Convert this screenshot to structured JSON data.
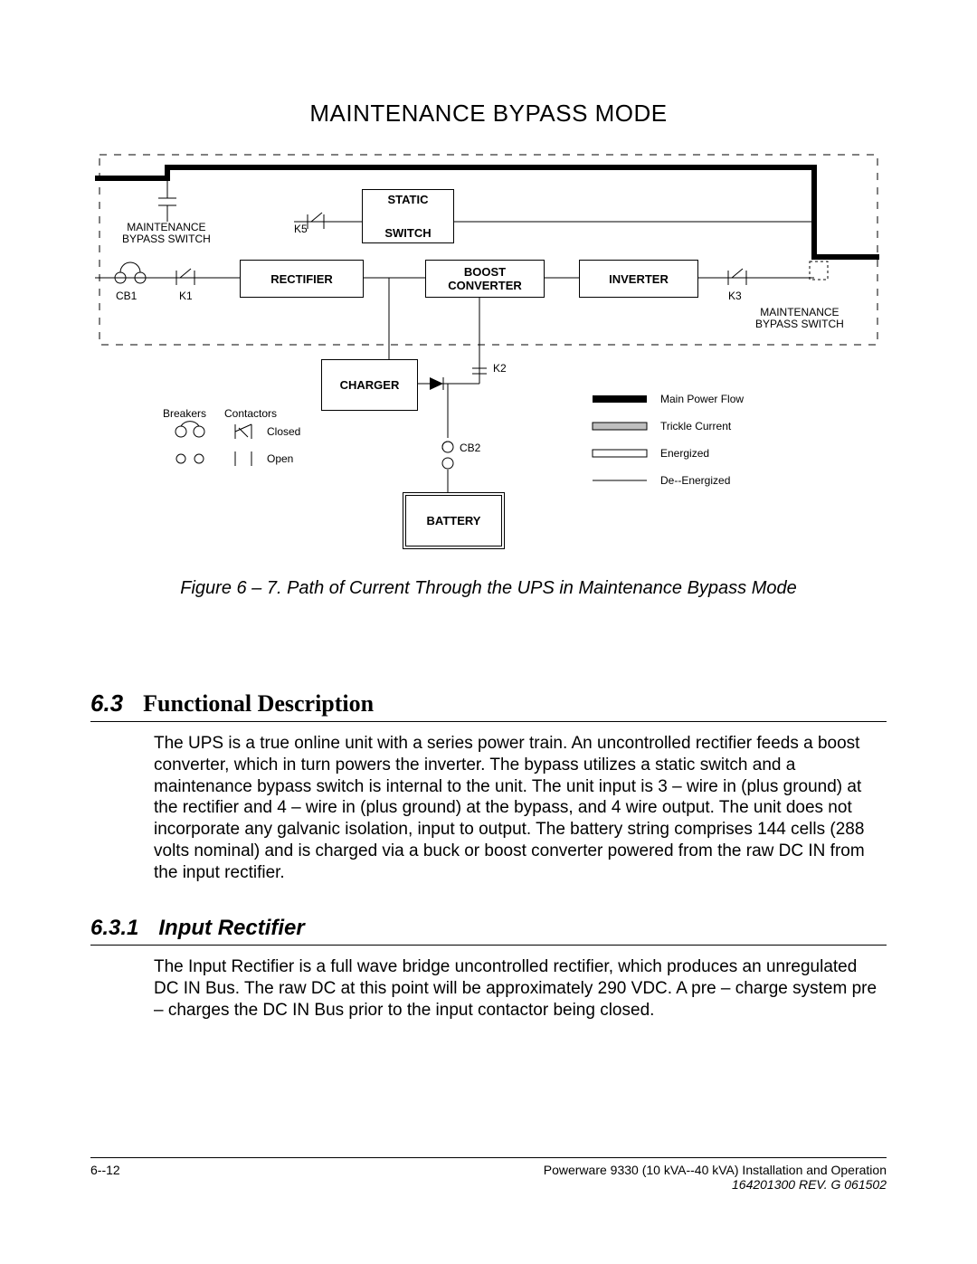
{
  "diagram": {
    "title": "MAINTENANCE BYPASS MODE",
    "caption": "Figure 6 – 7.   Path of Current Through the UPS in Maintenance Bypass Mode",
    "blocks": {
      "static_switch_top": "STATIC",
      "static_switch_bot": "SWITCH",
      "rectifier": "RECTIFIER",
      "boost_converter": "BOOST\nCONVERTER",
      "inverter": "INVERTER",
      "charger": "CHARGER",
      "battery": "BATTERY"
    },
    "labels": {
      "maint_bypass_switch_left": "MAINTENANCE\nBYPASS SWITCH",
      "maint_bypass_switch_right": "MAINTENANCE\nBYPASS SWITCH",
      "k5": "K5",
      "cb1": "CB1",
      "k1": "K1",
      "k2": "K2",
      "k3": "K3",
      "cb2": "CB2"
    },
    "legend": {
      "breakers": "Breakers",
      "contactors": "Contactors",
      "closed": "Closed",
      "open": "Open",
      "main_power_flow": "Main Power Flow",
      "trickle_current": "Trickle Current",
      "energized": "Energized",
      "de_energized": "De--Energized"
    }
  },
  "section_6_3": {
    "num": "6.3",
    "title": "Functional Description",
    "body": "The UPS is a true online unit with a series power train. An uncontrolled rectifier feeds a boost converter, which in turn powers the inverter. The bypass utilizes a static switch and a maintenance bypass switch is internal to the unit. The unit input is 3 – wire in (plus ground) at the rectifier and 4 – wire in (plus ground) at the bypass, and 4 wire output. The unit does not incorporate any galvanic isolation, input to output. The battery string comprises 144 cells (288 volts nominal) and is charged via a buck or boost converter powered from the raw DC IN from the input rectifier."
  },
  "section_6_3_1": {
    "num": "6.3.1",
    "title": "Input Rectifier",
    "body": "The Input Rectifier is a full wave bridge uncontrolled rectifier, which produces an unregulated DC IN Bus. The raw DC at this point will be approximately 290 VDC. A pre – charge system pre – charges the DC IN Bus prior to the input contactor being closed."
  },
  "footer": {
    "page": "6--12",
    "doc": "Powerware 9330 (10 kVA--40 kVA) Installation and Operation",
    "rev": "164201300 REV. G  061502"
  }
}
